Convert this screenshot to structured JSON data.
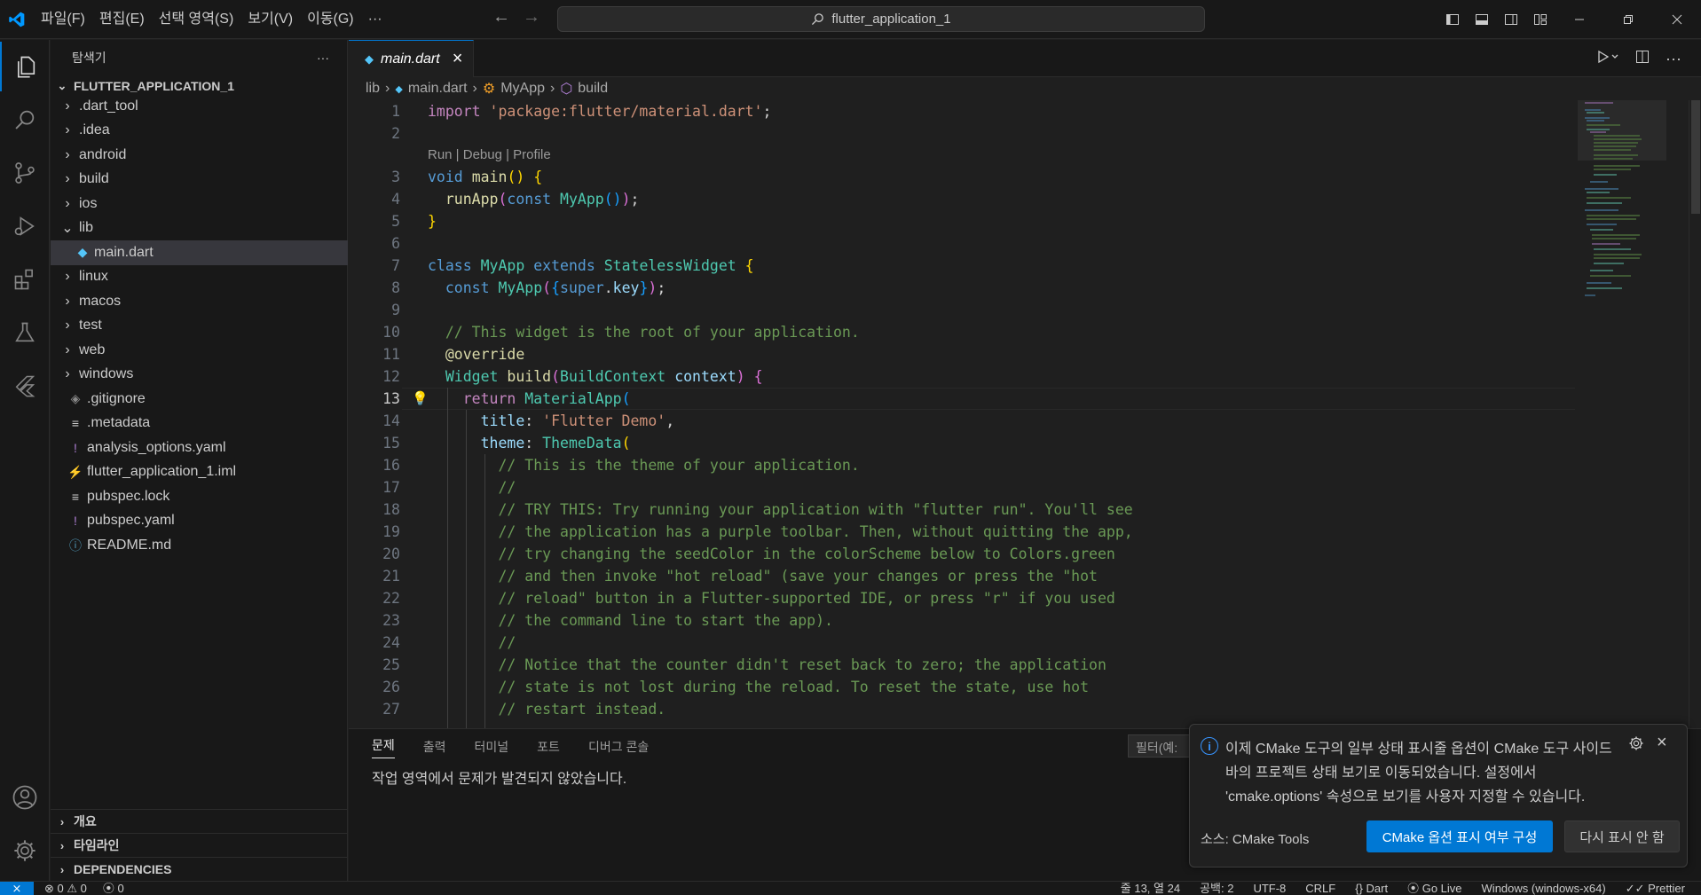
{
  "colors": {
    "accent": "#0078d4",
    "editor_bg": "#1f1f1f",
    "sidebar_bg": "#181818",
    "keyword": "#569cd6",
    "type": "#4ec9b0",
    "string": "#ce9178",
    "comment": "#6a9955",
    "function": "#dcdcaa"
  },
  "titlebar": {
    "menu": [
      "파일(F)",
      "편집(E)",
      "선택 영역(S)",
      "보기(V)",
      "이동(G)",
      "···"
    ],
    "search_text": "flutter_application_1"
  },
  "activitybar": {
    "icons": [
      "explorer-icon",
      "search-icon",
      "source-control-icon",
      "run-debug-icon",
      "extensions-icon",
      "testing-icon",
      "flutter-icon",
      "account-icon",
      "manage-gear-icon"
    ]
  },
  "sidebar": {
    "title": "탐색기",
    "more": "···",
    "root": "FLUTTER_APPLICATION_1",
    "items": [
      {
        "label": ".dart_tool",
        "type": "folder",
        "open": false
      },
      {
        "label": ".idea",
        "type": "folder",
        "open": false
      },
      {
        "label": "android",
        "type": "folder",
        "open": false
      },
      {
        "label": "build",
        "type": "folder",
        "open": false
      },
      {
        "label": "ios",
        "type": "folder",
        "open": false
      },
      {
        "label": "lib",
        "type": "folder",
        "open": true
      },
      {
        "label": "main.dart",
        "type": "dart",
        "selected": true
      },
      {
        "label": "linux",
        "type": "folder",
        "open": false
      },
      {
        "label": "macos",
        "type": "folder",
        "open": false
      },
      {
        "label": "test",
        "type": "folder",
        "open": false
      },
      {
        "label": "web",
        "type": "folder",
        "open": false
      },
      {
        "label": "windows",
        "type": "folder",
        "open": false
      },
      {
        "label": ".gitignore",
        "type": "git"
      },
      {
        "label": ".metadata",
        "type": "lines"
      },
      {
        "label": "analysis_options.yaml",
        "type": "yaml"
      },
      {
        "label": "flutter_application_1.iml",
        "type": "rss"
      },
      {
        "label": "pubspec.lock",
        "type": "lines"
      },
      {
        "label": "pubspec.yaml",
        "type": "yaml"
      },
      {
        "label": "README.md",
        "type": "info"
      }
    ],
    "bottom_sections": [
      "개요",
      "타임라인",
      "DEPENDENCIES"
    ]
  },
  "editor": {
    "tab": {
      "label": "main.dart",
      "close": "×"
    },
    "breadcrumb": [
      "lib",
      "main.dart",
      "MyApp",
      "build"
    ],
    "codelens": "Run | Debug | Profile",
    "current_line": 13,
    "lines": [
      {
        "n": "1",
        "tokens": [
          [
            "kw2",
            "import"
          ],
          [
            "pn",
            " "
          ],
          [
            "str",
            "'package:flutter/material.dart'"
          ],
          [
            "pn",
            ";"
          ]
        ]
      },
      {
        "n": "2",
        "tokens": []
      },
      {
        "n": "3",
        "tokens": [
          [
            "kw",
            "void"
          ],
          [
            "pn",
            " "
          ],
          [
            "fn",
            "main"
          ],
          [
            "br1",
            "()"
          ],
          [
            "pn",
            " "
          ],
          [
            "br1",
            "{"
          ]
        ]
      },
      {
        "n": "4",
        "tokens": [
          [
            "pn",
            "  "
          ],
          [
            "fn",
            "runApp"
          ],
          [
            "br2",
            "("
          ],
          [
            "kw",
            "const"
          ],
          [
            "pn",
            " "
          ],
          [
            "ty",
            "MyApp"
          ],
          [
            "br3",
            "()"
          ],
          [
            "br2",
            ")"
          ],
          [
            "pn",
            ";"
          ]
        ]
      },
      {
        "n": "5",
        "tokens": [
          [
            "br1",
            "}"
          ]
        ]
      },
      {
        "n": "6",
        "tokens": []
      },
      {
        "n": "7",
        "tokens": [
          [
            "kw",
            "class"
          ],
          [
            "pn",
            " "
          ],
          [
            "ty",
            "MyApp"
          ],
          [
            "pn",
            " "
          ],
          [
            "kw",
            "extends"
          ],
          [
            "pn",
            " "
          ],
          [
            "ty",
            "StatelessWidget"
          ],
          [
            "pn",
            " "
          ],
          [
            "br1",
            "{"
          ]
        ]
      },
      {
        "n": "8",
        "tokens": [
          [
            "pn",
            "  "
          ],
          [
            "kw",
            "const"
          ],
          [
            "pn",
            " "
          ],
          [
            "ty",
            "MyApp"
          ],
          [
            "br2",
            "("
          ],
          [
            "br3",
            "{"
          ],
          [
            "kw",
            "super"
          ],
          [
            "pn",
            "."
          ],
          [
            "var",
            "key"
          ],
          [
            "br3",
            "}"
          ],
          [
            "br2",
            ")"
          ],
          [
            "pn",
            ";"
          ]
        ]
      },
      {
        "n": "9",
        "tokens": []
      },
      {
        "n": "10",
        "tokens": [
          [
            "pn",
            "  "
          ],
          [
            "cm",
            "// This widget is the root of your application."
          ]
        ]
      },
      {
        "n": "11",
        "tokens": [
          [
            "pn",
            "  "
          ],
          [
            "ann",
            "@override"
          ]
        ]
      },
      {
        "n": "12",
        "tokens": [
          [
            "pn",
            "  "
          ],
          [
            "ty",
            "Widget"
          ],
          [
            "pn",
            " "
          ],
          [
            "fn",
            "build"
          ],
          [
            "br2",
            "("
          ],
          [
            "ty",
            "BuildContext"
          ],
          [
            "pn",
            " "
          ],
          [
            "var",
            "context"
          ],
          [
            "br2",
            ")"
          ],
          [
            "pn",
            " "
          ],
          [
            "br2",
            "{"
          ]
        ]
      },
      {
        "n": "13",
        "tokens": [
          [
            "pn",
            "    "
          ],
          [
            "kw2",
            "return"
          ],
          [
            "pn",
            " "
          ],
          [
            "ty",
            "MaterialApp"
          ],
          [
            "br3",
            "("
          ]
        ]
      },
      {
        "n": "14",
        "tokens": [
          [
            "pn",
            "      "
          ],
          [
            "var",
            "title"
          ],
          [
            "pn",
            ": "
          ],
          [
            "str",
            "'Flutter Demo'"
          ],
          [
            "pn",
            ","
          ]
        ]
      },
      {
        "n": "15",
        "tokens": [
          [
            "pn",
            "      "
          ],
          [
            "var",
            "theme"
          ],
          [
            "pn",
            ": "
          ],
          [
            "ty",
            "ThemeData"
          ],
          [
            "br1",
            "("
          ]
        ]
      },
      {
        "n": "16",
        "tokens": [
          [
            "pn",
            "        "
          ],
          [
            "cm",
            "// This is the theme of your application."
          ]
        ]
      },
      {
        "n": "17",
        "tokens": [
          [
            "pn",
            "        "
          ],
          [
            "cm",
            "//"
          ]
        ]
      },
      {
        "n": "18",
        "tokens": [
          [
            "pn",
            "        "
          ],
          [
            "cm",
            "// TRY THIS: Try running your application with \"flutter run\". You'll see"
          ]
        ]
      },
      {
        "n": "19",
        "tokens": [
          [
            "pn",
            "        "
          ],
          [
            "cm",
            "// the application has a purple toolbar. Then, without quitting the app,"
          ]
        ]
      },
      {
        "n": "20",
        "tokens": [
          [
            "pn",
            "        "
          ],
          [
            "cm",
            "// try changing the seedColor in the colorScheme below to Colors.green"
          ]
        ]
      },
      {
        "n": "21",
        "tokens": [
          [
            "pn",
            "        "
          ],
          [
            "cm",
            "// and then invoke \"hot reload\" (save your changes or press the \"hot"
          ]
        ]
      },
      {
        "n": "22",
        "tokens": [
          [
            "pn",
            "        "
          ],
          [
            "cm",
            "// reload\" button in a Flutter-supported IDE, or press \"r\" if you used"
          ]
        ]
      },
      {
        "n": "23",
        "tokens": [
          [
            "pn",
            "        "
          ],
          [
            "cm",
            "// the command line to start the app)."
          ]
        ]
      },
      {
        "n": "24",
        "tokens": [
          [
            "pn",
            "        "
          ],
          [
            "cm",
            "//"
          ]
        ]
      },
      {
        "n": "25",
        "tokens": [
          [
            "pn",
            "        "
          ],
          [
            "cm",
            "// Notice that the counter didn't reset back to zero; the application"
          ]
        ]
      },
      {
        "n": "26",
        "tokens": [
          [
            "pn",
            "        "
          ],
          [
            "cm",
            "// state is not lost during the reload. To reset the state, use hot"
          ]
        ]
      },
      {
        "n": "27",
        "tokens": [
          [
            "pn",
            "        "
          ],
          [
            "cm",
            "// restart instead."
          ]
        ]
      }
    ]
  },
  "panel": {
    "tabs": [
      "문제",
      "출력",
      "터미널",
      "포트",
      "디버그 콘솔"
    ],
    "filter_placeholder": "필터(예:",
    "message": "작업 영역에서 문제가 발견되지 않았습니다."
  },
  "notification": {
    "message": "이제 CMake 도구의 일부 상태 표시줄 옵션이 CMake 도구 사이드바의 프로젝트 상태 보기로 이동되었습니다. 설정에서 'cmake.options' 속성으로 보기를 사용자 지정할 수 있습니다.",
    "source": "소스: CMake Tools",
    "primary_button": "CMake 옵션 표시 여부 구성",
    "secondary_button": "다시 표시 안 함"
  },
  "statusbar": {
    "errors": "0",
    "warnings": "0",
    "ports": "0",
    "position": "줄 13, 열 24",
    "spaces": "공백: 2",
    "encoding": "UTF-8",
    "eol": "CRLF",
    "language": "{} Dart",
    "golive": "Go Live",
    "device": "Windows (windows-x64)",
    "prettier": "Prettier"
  }
}
